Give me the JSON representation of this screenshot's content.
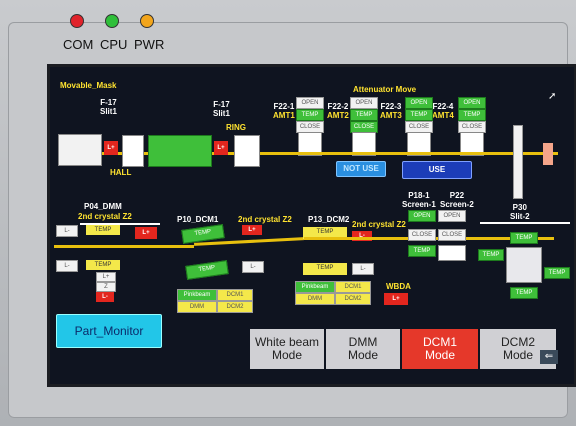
{
  "leds": [
    {
      "label": "COM",
      "color": "#e0232b"
    },
    {
      "label": "CPU",
      "color": "#2fbf3a"
    },
    {
      "label": "PWR",
      "color": "#f2a51c"
    }
  ],
  "screen": {
    "movable_mask": "Movable_Mask",
    "attenuator_move": "Attenuator Move",
    "f17_slit1_a": {
      "line1": "F-17",
      "line2": "Slit1"
    },
    "f17_slit1_b": {
      "line1": "F-17",
      "line2": "Slit1"
    },
    "hall": "HALL",
    "ring": "RING",
    "attenuators": [
      {
        "line1": "F22-1",
        "line2": "AMT1"
      },
      {
        "line1": "F22-2",
        "line2": "AMT2"
      },
      {
        "line1": "F22-3",
        "line2": "AMT3"
      },
      {
        "line1": "F22-4",
        "line2": "AMT4"
      }
    ],
    "open": "OPEN",
    "close": "CLOSE",
    "temp": "TEMP",
    "not_use": "NOT USE",
    "use": "USE",
    "p04_dmm": "P04_DMM",
    "crystal_z2_a": "2nd crystal Z2",
    "p10_dcm1": "P10_DCM1",
    "crystal_z2_b": "2nd crystal Z2",
    "p13_dcm2": "P13_DCM2",
    "crystal_z2_c": "2nd crystal Z2",
    "screen1": {
      "line1": "P18-1",
      "line2": "Screen-1"
    },
    "screen2": {
      "line1": "P22",
      "line2": "Screen-2"
    },
    "slit2": {
      "line1": "P30",
      "line2": "Slit-2"
    },
    "pinkbeam": "Pinkbeam",
    "dmm": "DMM",
    "dcm1": "DCM1",
    "dcm2": "DCM2",
    "wbda": "WBDA",
    "lplus": "L+",
    "lminus": "L-",
    "z": "Z",
    "part_monitor": "Part_Monitor",
    "modes": [
      {
        "line1": "White beam",
        "line2": "Mode",
        "active": false
      },
      {
        "line1": "DMM",
        "line2": "Mode",
        "active": false
      },
      {
        "line1": "DCM1",
        "line2": "Mode",
        "active": true
      },
      {
        "line1": "DCM2",
        "line2": "Mode",
        "active": false
      }
    ]
  }
}
